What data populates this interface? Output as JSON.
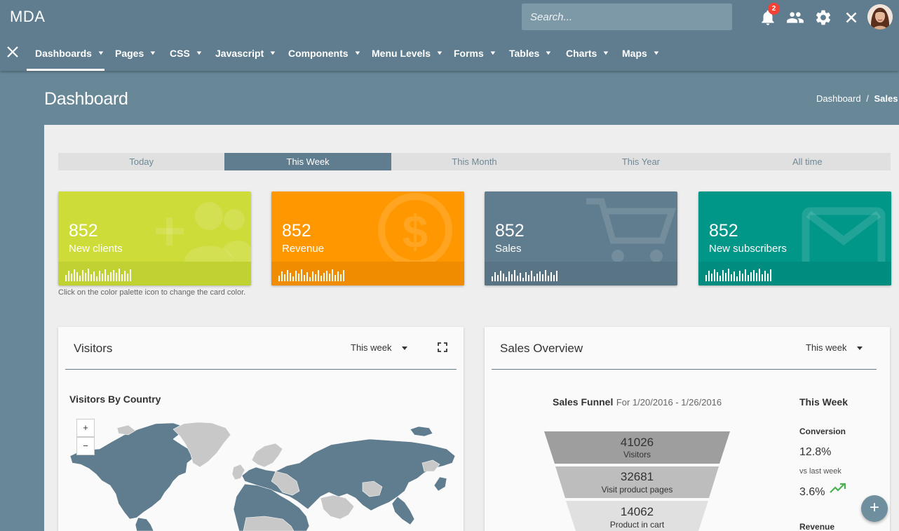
{
  "app": {
    "brand": "MDA"
  },
  "topbar": {
    "search_placeholder": "Search...",
    "notification_count": "2",
    "icons": [
      "bell-icon",
      "people-icon",
      "gear-icon",
      "close-icon"
    ]
  },
  "nav": {
    "items": [
      {
        "label": "Dashboards",
        "active": true
      },
      {
        "label": "Pages"
      },
      {
        "label": "CSS"
      },
      {
        "label": "Javascript"
      },
      {
        "label": "Components"
      },
      {
        "label": "Menu Levels"
      },
      {
        "label": "Forms"
      },
      {
        "label": "Tables"
      },
      {
        "label": "Charts"
      },
      {
        "label": "Maps"
      }
    ]
  },
  "header": {
    "title": "Dashboard",
    "breadcrumb": [
      "Dashboard",
      "Sales"
    ],
    "separator": "/"
  },
  "period_tabs": {
    "items": [
      "Today",
      "This Week",
      "This Month",
      "This Year",
      "All time"
    ],
    "active": "This Week"
  },
  "stats": [
    {
      "value": "852",
      "label": "New clients",
      "color": "#cddc39",
      "foot_color": "#c0d132",
      "icon": "add-user-icon"
    },
    {
      "value": "852",
      "label": "Revenue",
      "color": "#ff9800",
      "foot_color": "#f08c00",
      "icon": "dollar-coin-icon"
    },
    {
      "value": "852",
      "label": "Sales",
      "color": "#5f7d8e",
      "foot_color": "#597585",
      "icon": "shopping-cart-icon"
    },
    {
      "value": "852",
      "label": "New subscribers",
      "color": "#009688",
      "foot_color": "#008c7f",
      "icon": "mail-icon"
    }
  ],
  "hint": "Click on the color palette icon to change the card color.",
  "visitors_card": {
    "title": "Visitors",
    "range": "This week",
    "map_title": "Visitors By Country",
    "zoom_in": "+",
    "zoom_out": "−",
    "map_colors": {
      "land": "#5f7d8e",
      "other": "#c8c8c8"
    }
  },
  "sales_card": {
    "title": "Sales Overview",
    "range": "This week",
    "funnel_title": "Sales Funnel",
    "funnel_range": "For 1/20/2016 - 1/26/2016",
    "funnel": [
      {
        "value": "41026",
        "label": "Visitors",
        "color": "#9e9e9e"
      },
      {
        "value": "32681",
        "label": "Visit product pages",
        "color": "#bdbdbd"
      },
      {
        "value": "14062",
        "label": "Product in cart",
        "color": "#e0e0e0"
      }
    ],
    "side": {
      "heading": "This Week",
      "conversion_label": "Conversion",
      "conversion_value": "12.8%",
      "vs_label": "vs last week",
      "vs_value": "3.6%",
      "revenue_label": "Revenue",
      "trend_color": "#4caf50"
    }
  },
  "fab": {
    "label": "+"
  }
}
